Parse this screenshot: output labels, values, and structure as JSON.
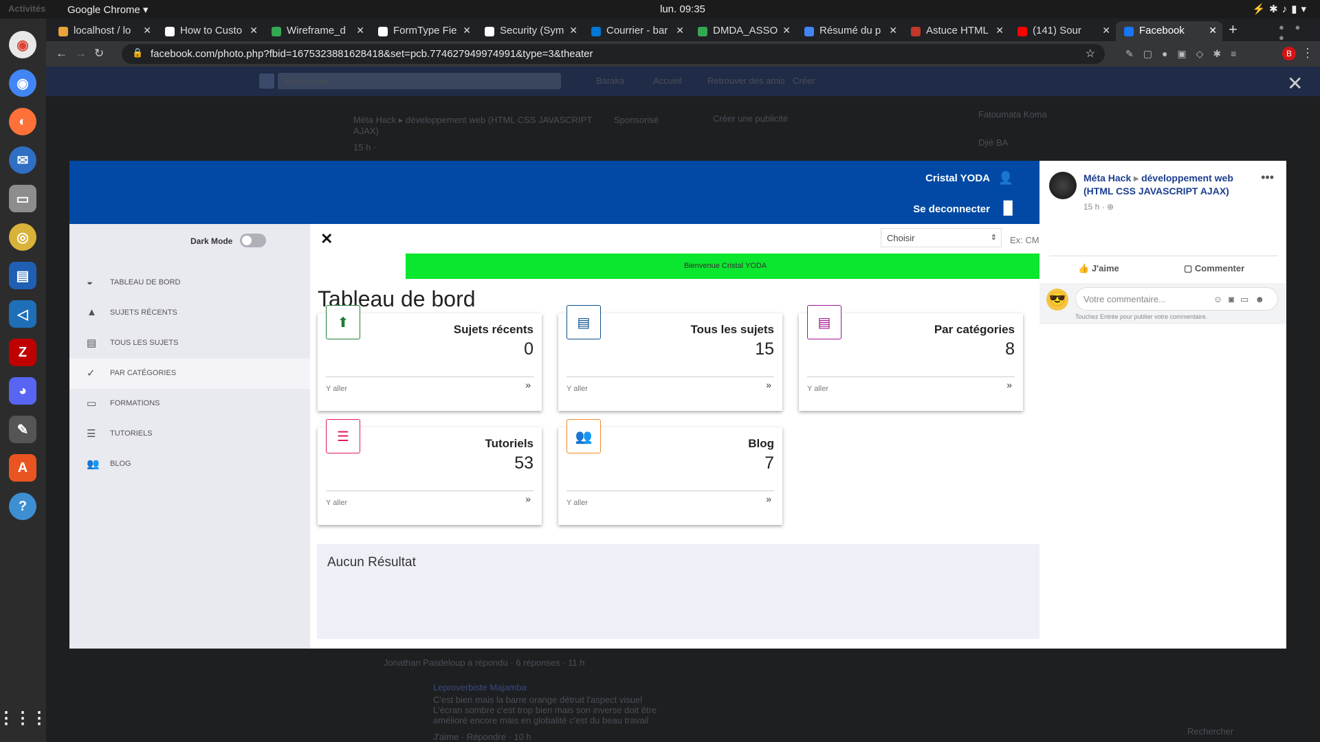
{
  "os": {
    "activities": "Activités",
    "app_name": "Google Chrome ▾",
    "clock": "lun. 09:35"
  },
  "browser": {
    "tabs": [
      {
        "label": "localhost / lo",
        "color": "#e8a33d"
      },
      {
        "label": "How to Custo",
        "color": "#ffffff"
      },
      {
        "label": "Wireframe_d",
        "color": "#34a853"
      },
      {
        "label": "FormType Fie",
        "color": "#ffffff"
      },
      {
        "label": "Security (Sym",
        "color": "#ffffff"
      },
      {
        "label": "Courrier - bar",
        "color": "#0078d4"
      },
      {
        "label": "DMDA_ASSO",
        "color": "#34a853"
      },
      {
        "label": "Résumé du p",
        "color": "#4285f4"
      },
      {
        "label": "Astuce HTML",
        "color": "#c0392b"
      },
      {
        "label": "(141) Sour",
        "color": "#ff0000"
      },
      {
        "label": "Facebook",
        "color": "#1877f2"
      }
    ],
    "url": "facebook.com/photo.php?fbid=1675323881628418&set=pcb.774627949974991&type=3&theater",
    "profile_letter": "B"
  },
  "fb_background": {
    "search_placeholder": "Rechercher",
    "nav": [
      "Baraka",
      "Accueil",
      "Retrouver des amis",
      "Créer"
    ],
    "post_author": "Méta Hack ▸ développement web (HTML CSS JAVASCRIPT AJAX)",
    "post_time": "15 h ·",
    "sponsored": "Sponsorisé",
    "create_ad": "Créer une publicité",
    "contacts": [
      "Fatoumata Koma",
      "Djiè BA"
    ],
    "reply_line": "Jonathan Pasdeloup a répondu · 6 réponses · 11 h",
    "comment_author": "Leproverbiste Majamba",
    "comment_text": "C'est bien mais la barre orange détruit l'aspect visuel L'écran sombre c'est trop bien mais son inverse doit être amélioré encore mais en globalité c'est du beau travail",
    "comment_meta": "J'aime · Répondre · 10 h",
    "chat_search": "Rechercher"
  },
  "app": {
    "header_user": "Cristal YODA",
    "header_logout": "Se deconnecter",
    "dark_mode_label": "Dark Mode",
    "sidebar": [
      {
        "label": "TABLEAU DE BORD",
        "icon": "gauge-icon"
      },
      {
        "label": "SUJETS RÉCENTS",
        "icon": "file-upload-icon"
      },
      {
        "label": "TOUS LES SUJETS",
        "icon": "file-icon"
      },
      {
        "label": "PAR CATÉGORIES",
        "icon": "clipboard-check-icon"
      },
      {
        "label": "FORMATIONS",
        "icon": "money-icon"
      },
      {
        "label": "TUTORIELS",
        "icon": "clipboard-list-icon"
      },
      {
        "label": "BLOG",
        "icon": "users-icon"
      }
    ],
    "select_value": "Choisir",
    "search_placeholder": "Ex: CM",
    "welcome": "Bienvenue Cristal YODA",
    "page_title": "Tableau de bord",
    "cards": [
      {
        "name": "Sujets récents",
        "value": "0",
        "go": "Y aller",
        "color": "#1e7e34",
        "icon": "⬆"
      },
      {
        "name": "Tous les sujets",
        "value": "15",
        "go": "Y aller",
        "color": "#0d4f8b",
        "icon": "▤"
      },
      {
        "name": "Par catégories",
        "value": "8",
        "go": "Y aller",
        "color": "#a0128f",
        "icon": "▤"
      },
      {
        "name": "Tutoriels",
        "value": "53",
        "go": "Y aller",
        "color": "#e0185a",
        "icon": "☰"
      },
      {
        "name": "Blog",
        "value": "7",
        "go": "Y aller",
        "color": "#f08a24",
        "icon": "👥"
      }
    ],
    "no_result": "Aucun Résultat"
  },
  "panel": {
    "author": "Méta Hack",
    "group": "développement web (HTML CSS JAVASCRIPT AJAX)",
    "time": "15 h ·",
    "like": "J'aime",
    "comment": "Commenter",
    "comment_placeholder": "Votre commentaire...",
    "hint": "Touchez Entrée pour publier votre commentaire."
  }
}
